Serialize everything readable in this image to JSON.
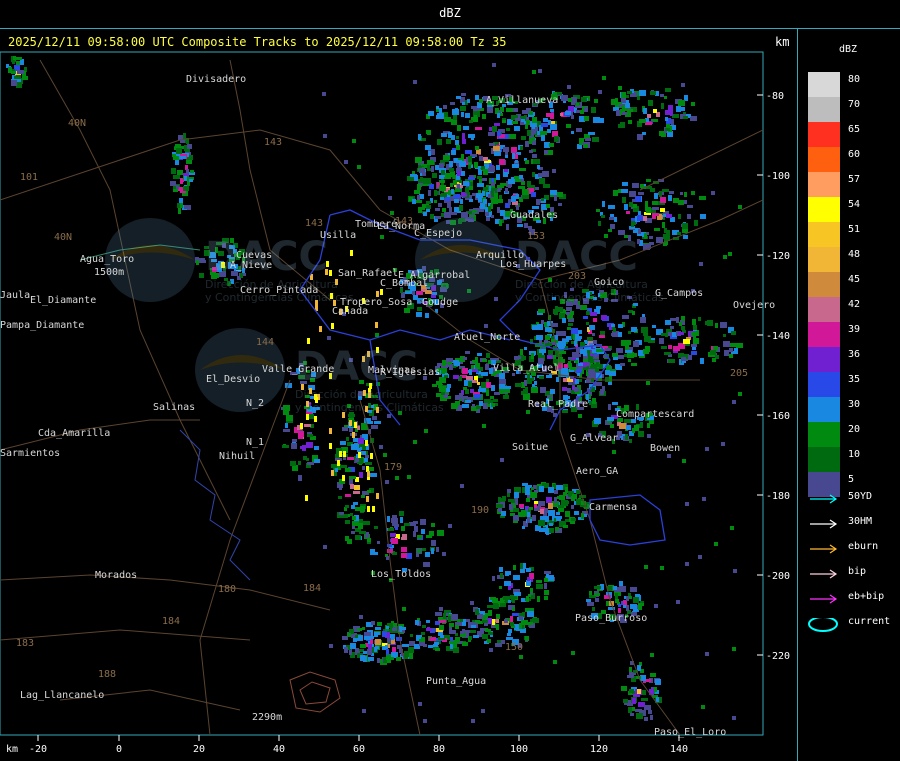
{
  "window": {
    "title": "dBZ"
  },
  "header": {
    "text": "2025/12/11 09:58:00 UTC Composite Tracks to 2025/12/11 09:58:00 Tz 35",
    "km_top": "km",
    "km_bottom": "km"
  },
  "x_axis": {
    "ticks": [
      "-20",
      "0",
      "20",
      "40",
      "60",
      "80",
      "100",
      "120",
      "140"
    ]
  },
  "y_axis": {
    "ticks": [
      "-80",
      "-100",
      "-120",
      "-140",
      "-160",
      "-180",
      "-200",
      "-220"
    ]
  },
  "watermark": {
    "text": "DACC",
    "subtitle_1": "Dirección de Agricultura",
    "subtitle_2": "y Contingencias Climáticas"
  },
  "places": [
    "Divisadero",
    "A_Villanueva",
    "Guadales",
    "Goico",
    "G_Campos",
    "Ovejero",
    "Agua_Toro",
    "1500m",
    "El_Diamante",
    "Pampa_Diamante",
    "Cerro_Pintada",
    "A_Nieve",
    "Cuevas",
    "Usilla",
    "La_Norma",
    "C_Espejo",
    "Arquillo",
    "Los_Huarpes",
    "C_Bombal",
    "San_Rafael",
    "E_Algarrobal",
    "Tropero_Sosa",
    "Goudge",
    "Cañada",
    "Atuel_Norte",
    "Villa_Atuel",
    "R_Iglesias",
    "Malvinas",
    "El_Desvio",
    "Valle_Grande",
    "Salinas",
    "Cda_Amarilla",
    "Nihuil",
    "N_1",
    "N_2",
    "Soitue",
    "G_Alvear",
    "Real_Padre",
    "Compartescard",
    "Bowen",
    "Aero_GA",
    "Carmensa",
    "Los_Toldos",
    "Morados",
    "Paso_Burroso",
    "Punta_Agua",
    "Lag_Llancanelo",
    "2290m",
    "Paso_El_Loro",
    "Tomberé",
    "Jaula",
    "Sarmientos"
  ],
  "roads": [
    "40N",
    "40N",
    "101",
    "143",
    "143",
    "143",
    "144",
    "150",
    "180",
    "184",
    "184",
    "183",
    "188",
    "205",
    "179",
    "190",
    "203",
    "153"
  ],
  "legend": {
    "title": "dBZ",
    "scale": [
      {
        "label": "80",
        "color": "#d8d8d8"
      },
      {
        "label": "70",
        "color": "#bdbdbd"
      },
      {
        "label": "65",
        "color": "#ff3020"
      },
      {
        "label": "60",
        "color": "#ff6010"
      },
      {
        "label": "57",
        "color": "#ff9c60"
      },
      {
        "label": "54",
        "color": "#ffff00"
      },
      {
        "label": "51",
        "color": "#f7c624"
      },
      {
        "label": "48",
        "color": "#f2b636"
      },
      {
        "label": "45",
        "color": "#d08a3c"
      },
      {
        "label": "42",
        "color": "#c8688c"
      },
      {
        "label": "39",
        "color": "#d01898"
      },
      {
        "label": "36",
        "color": "#7020d0"
      },
      {
        "label": "35",
        "color": "#2848e8"
      },
      {
        "label": "30",
        "color": "#1888e0"
      },
      {
        "label": "20",
        "color": "#008a10"
      },
      {
        "label": "10",
        "color": "#006a10"
      },
      {
        "label": "5",
        "color": "#484890"
      }
    ],
    "tracks": [
      {
        "label": "50YD",
        "color": "#00ffff"
      },
      {
        "label": "30HM",
        "color": "#ffffff"
      },
      {
        "label": "eburn",
        "color": "#ffb830"
      },
      {
        "label": "bip",
        "color": "#ffd0e0"
      },
      {
        "label": "eb+bip",
        "color": "#ff30ff"
      },
      {
        "label": "current",
        "color": "#00ffff"
      }
    ]
  }
}
